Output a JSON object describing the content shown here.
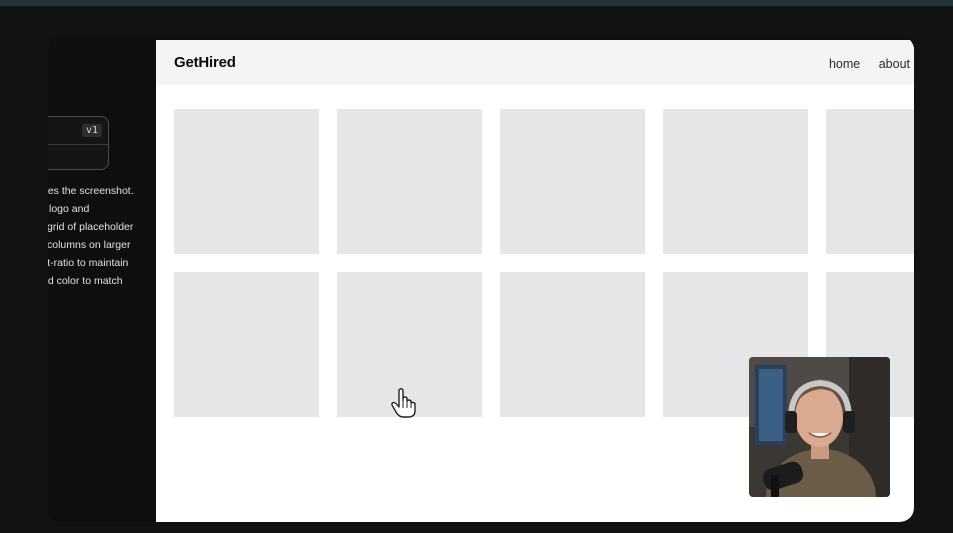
{
  "left_panel": {
    "version_badge": "v1",
    "description_lines": [
      "nes the screenshot.",
      "logo and",
      "grid of placeholder",
      "columns on larger",
      "ct-ratio to maintain",
      "nd color to match"
    ]
  },
  "preview": {
    "logo": "GetHired",
    "nav": [
      "home",
      "about"
    ],
    "grid": {
      "rows": 2,
      "visible_columns": 5
    }
  },
  "colors": {
    "page_background": "#111213",
    "preview_background": "#ffffff",
    "navbar_background": "#f4f4f5",
    "tile": "#e6e6e9"
  },
  "icons": [
    "hand-pointer-cursor-icon"
  ]
}
